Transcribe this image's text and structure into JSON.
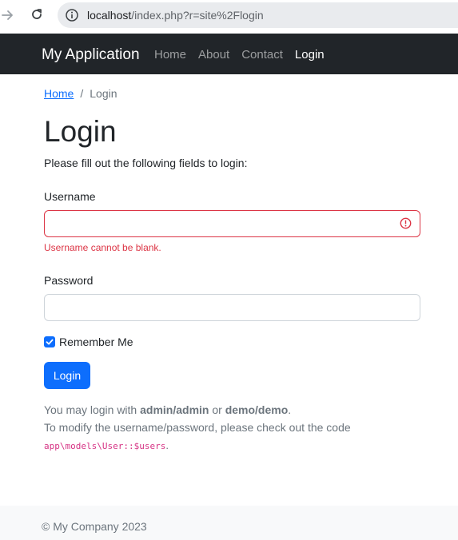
{
  "browser": {
    "url_host": "localhost",
    "url_path": "/index.php?r=site%2Flogin",
    "icons": [
      "forward-arrow-icon",
      "reload-icon",
      "info-icon"
    ]
  },
  "navbar": {
    "brand": "My Application",
    "links": [
      "Home",
      "About",
      "Contact",
      "Login"
    ],
    "active": "Login"
  },
  "breadcrumb": {
    "home": "Home",
    "separator": "/",
    "current": "Login"
  },
  "page": {
    "title": "Login",
    "intro": "Please fill out the following fields to login:"
  },
  "form": {
    "username_label": "Username",
    "username_value": "",
    "username_error": "Username cannot be blank.",
    "password_label": "Password",
    "password_value": "",
    "remember_label": "Remember Me",
    "remember_checked": true,
    "submit_label": "Login"
  },
  "hints": {
    "line1_prefix": "You may login with ",
    "cred1": "admin/admin",
    "line1_mid": " or ",
    "cred2": "demo/demo",
    "line1_suffix": ".",
    "line2": "To modify the username/password, please check out the code",
    "code": "app\\models\\User::$users",
    "code_suffix": "."
  },
  "footer": {
    "copyright": "© My Company 2023"
  },
  "colors": {
    "navbar_bg": "#212529",
    "primary": "#0d6efd",
    "danger": "#dc3545",
    "muted": "#6c757d",
    "code": "#d63384"
  }
}
